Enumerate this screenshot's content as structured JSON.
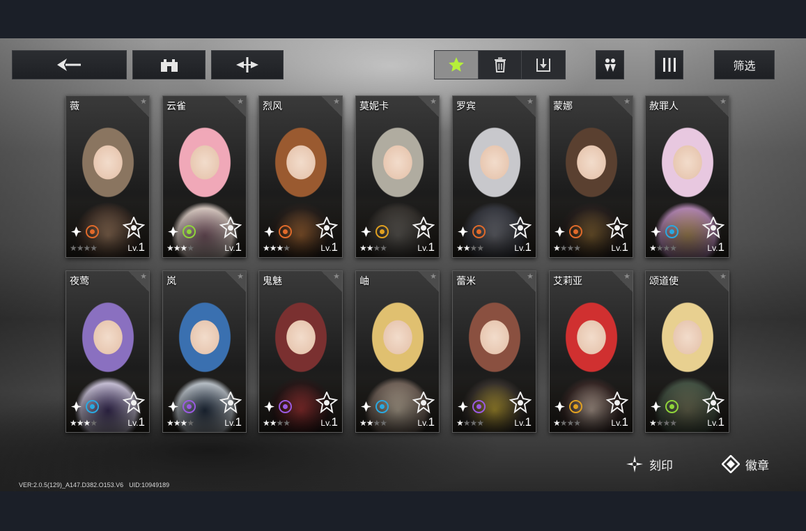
{
  "toolbar": {
    "filter_label": "筛选"
  },
  "characters": [
    {
      "name": "薇",
      "stars": 0,
      "level_prefix": "Lv.",
      "level": "1",
      "attribute_color": "#e06a2a",
      "palette": [
        "#8a7560",
        "#3e3028",
        "#b89070"
      ]
    },
    {
      "name": "云雀",
      "stars": 3,
      "level_prefix": "Lv.",
      "level": "1",
      "attribute_color": "#8fd43a",
      "palette": [
        "#f0a8b8",
        "#e8d8d0",
        "#9a7080"
      ]
    },
    {
      "name": "烈风",
      "stars": 3,
      "level_prefix": "Lv.",
      "level": "1",
      "attribute_color": "#e06a2a",
      "palette": [
        "#9a5a30",
        "#2a221e",
        "#c07a40"
      ]
    },
    {
      "name": "莫妮卡",
      "stars": 2,
      "level_prefix": "Lv.",
      "level": "1",
      "attribute_color": "#e0a020",
      "palette": [
        "#b0aca0",
        "#3a3632",
        "#7a7670"
      ]
    },
    {
      "name": "罗宾",
      "stars": 2,
      "level_prefix": "Lv.",
      "level": "1",
      "attribute_color": "#e06a2a",
      "palette": [
        "#c8c8cc",
        "#3a3c44",
        "#8a8c96"
      ]
    },
    {
      "name": "蒙娜",
      "stars": 1,
      "level_prefix": "Lv.",
      "level": "1",
      "attribute_color": "#e06a2a",
      "palette": [
        "#5a4030",
        "#2a2220",
        "#a07a40"
      ]
    },
    {
      "name": "赦罪人",
      "stars": 1,
      "level_prefix": "Lv.",
      "level": "1",
      "attribute_color": "#2aa8e0",
      "palette": [
        "#e8c8e0",
        "#c090c0",
        "#d8b070"
      ]
    },
    {
      "name": "夜莺",
      "stars": 3,
      "level_prefix": "Lv.",
      "level": "1",
      "attribute_color": "#2aa8e0",
      "palette": [
        "#8a70c0",
        "#d8d0e8",
        "#4a3a70"
      ]
    },
    {
      "name": "岚",
      "stars": 3,
      "level_prefix": "Lv.",
      "level": "1",
      "attribute_color": "#9a5ae0",
      "palette": [
        "#3a70b0",
        "#c8d0d8",
        "#2a3a50"
      ]
    },
    {
      "name": "鬼魅",
      "stars": 2,
      "level_prefix": "Lv.",
      "level": "1",
      "attribute_color": "#9a5ae0",
      "palette": [
        "#7a3030",
        "#2a1a1a",
        "#c04040"
      ]
    },
    {
      "name": "岫",
      "stars": 2,
      "level_prefix": "Lv.",
      "level": "1",
      "attribute_color": "#2aa8e0",
      "palette": [
        "#e0c070",
        "#7a6a60",
        "#e8d8c0"
      ]
    },
    {
      "name": "蕾米",
      "stars": 1,
      "level_prefix": "Lv.",
      "level": "1",
      "attribute_color": "#9a5ae0",
      "palette": [
        "#8a5040",
        "#3a3430",
        "#e0c040"
      ]
    },
    {
      "name": "艾莉亚",
      "stars": 1,
      "level_prefix": "Lv.",
      "level": "1",
      "attribute_color": "#e0a020",
      "palette": [
        "#d03030",
        "#3a2a28",
        "#e8d0c0"
      ]
    },
    {
      "name": "颂道使",
      "stars": 1,
      "level_prefix": "Lv.",
      "level": "1",
      "attribute_color": "#8fd43a",
      "palette": [
        "#e8d090",
        "#4a5a4a",
        "#8a8a6a"
      ]
    }
  ],
  "bottom_actions": {
    "imprint_label": "刻印",
    "badge_label": "徽章"
  },
  "footer": {
    "version": "VER:2.0.5(129)_A147.D382.O153.V6",
    "uid": "UID:10949189"
  }
}
